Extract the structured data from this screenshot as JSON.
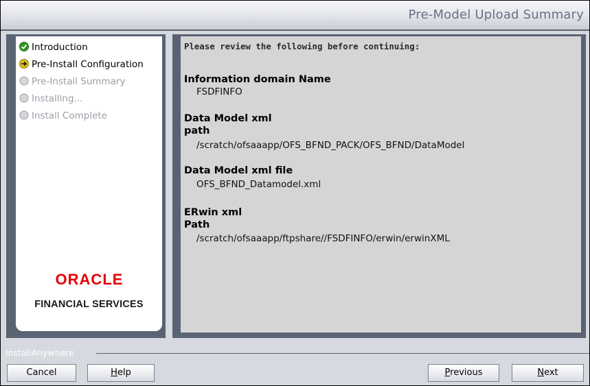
{
  "header": {
    "title": "Pre-Model Upload Summary"
  },
  "steps": [
    {
      "label": "Introduction",
      "state": "done"
    },
    {
      "label": "Pre-Install Configuration",
      "state": "current"
    },
    {
      "label": "Pre-Install Summary",
      "state": "pending"
    },
    {
      "label": "Installing...",
      "state": "pending"
    },
    {
      "label": "Install Complete",
      "state": "pending"
    }
  ],
  "logo": {
    "oracle": "ORACLE",
    "financial": "FINANCIAL SERVICES"
  },
  "content": {
    "instruction": "Please review the following before continuing:",
    "fields": [
      {
        "label": "Information domain Name",
        "value": "FSDFINFO"
      },
      {
        "label": "Data Model xml",
        "label2": "path",
        "value": "/scratch/ofsaaapp/OFS_BFND_PACK/OFS_BFND/DataModel"
      },
      {
        "label": "Data Model xml file",
        "value": "OFS_BFND_Datamodel.xml"
      },
      {
        "label": "ERwin xml",
        "label2": "Path",
        "value": "/scratch/ofsaaapp/ftpshare//FSDFINFO/erwin/erwinXML"
      }
    ]
  },
  "footer": {
    "brand": "InstallAnywhere",
    "cancel": "Cancel",
    "help_rest": "elp",
    "help_mnemonic": "H",
    "previous_mnemonic": "P",
    "previous_rest": "revious",
    "next_mnemonic": "N",
    "next_rest": "ext"
  },
  "colors": {
    "done": "#2f9a1f",
    "current": "#e2c21a",
    "pending": "#c7c9ce",
    "oracle_red": "#e60000"
  }
}
